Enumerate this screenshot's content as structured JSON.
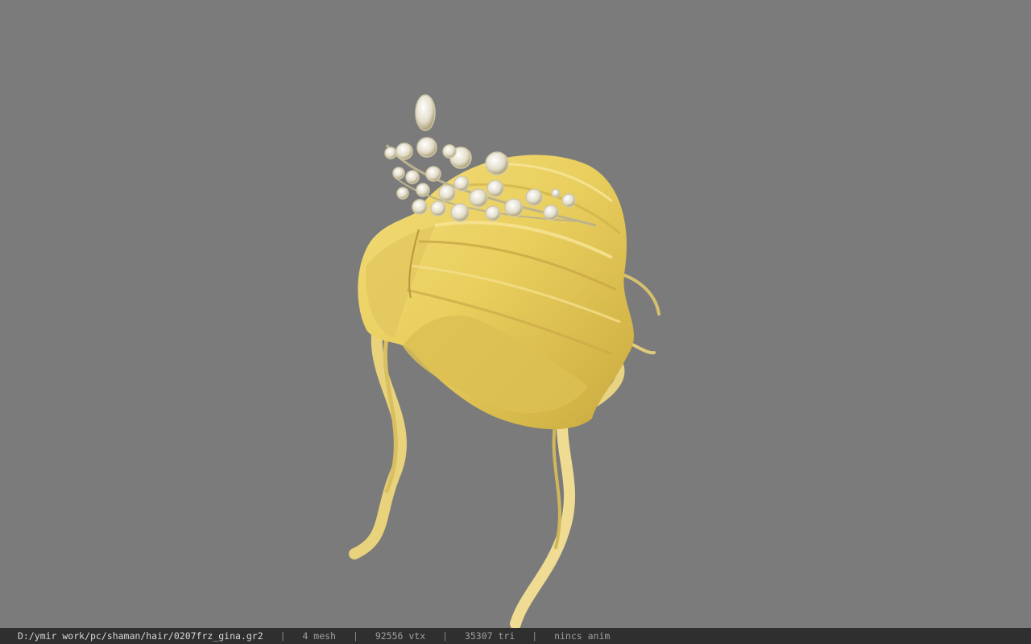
{
  "viewport": {
    "background": "#7b7b7b",
    "model": "hair-with-tiara",
    "hair_color": "#e6cf6a",
    "tiara_color": "#d8d2bc"
  },
  "status": {
    "file_path": "D:/ymir work/pc/shaman/hair/0207frz_gina.gr2",
    "sep": "|",
    "mesh": "4 mesh",
    "vtx": "92556 vtx",
    "tri": "35307 tri",
    "anim": "nincs anim"
  }
}
